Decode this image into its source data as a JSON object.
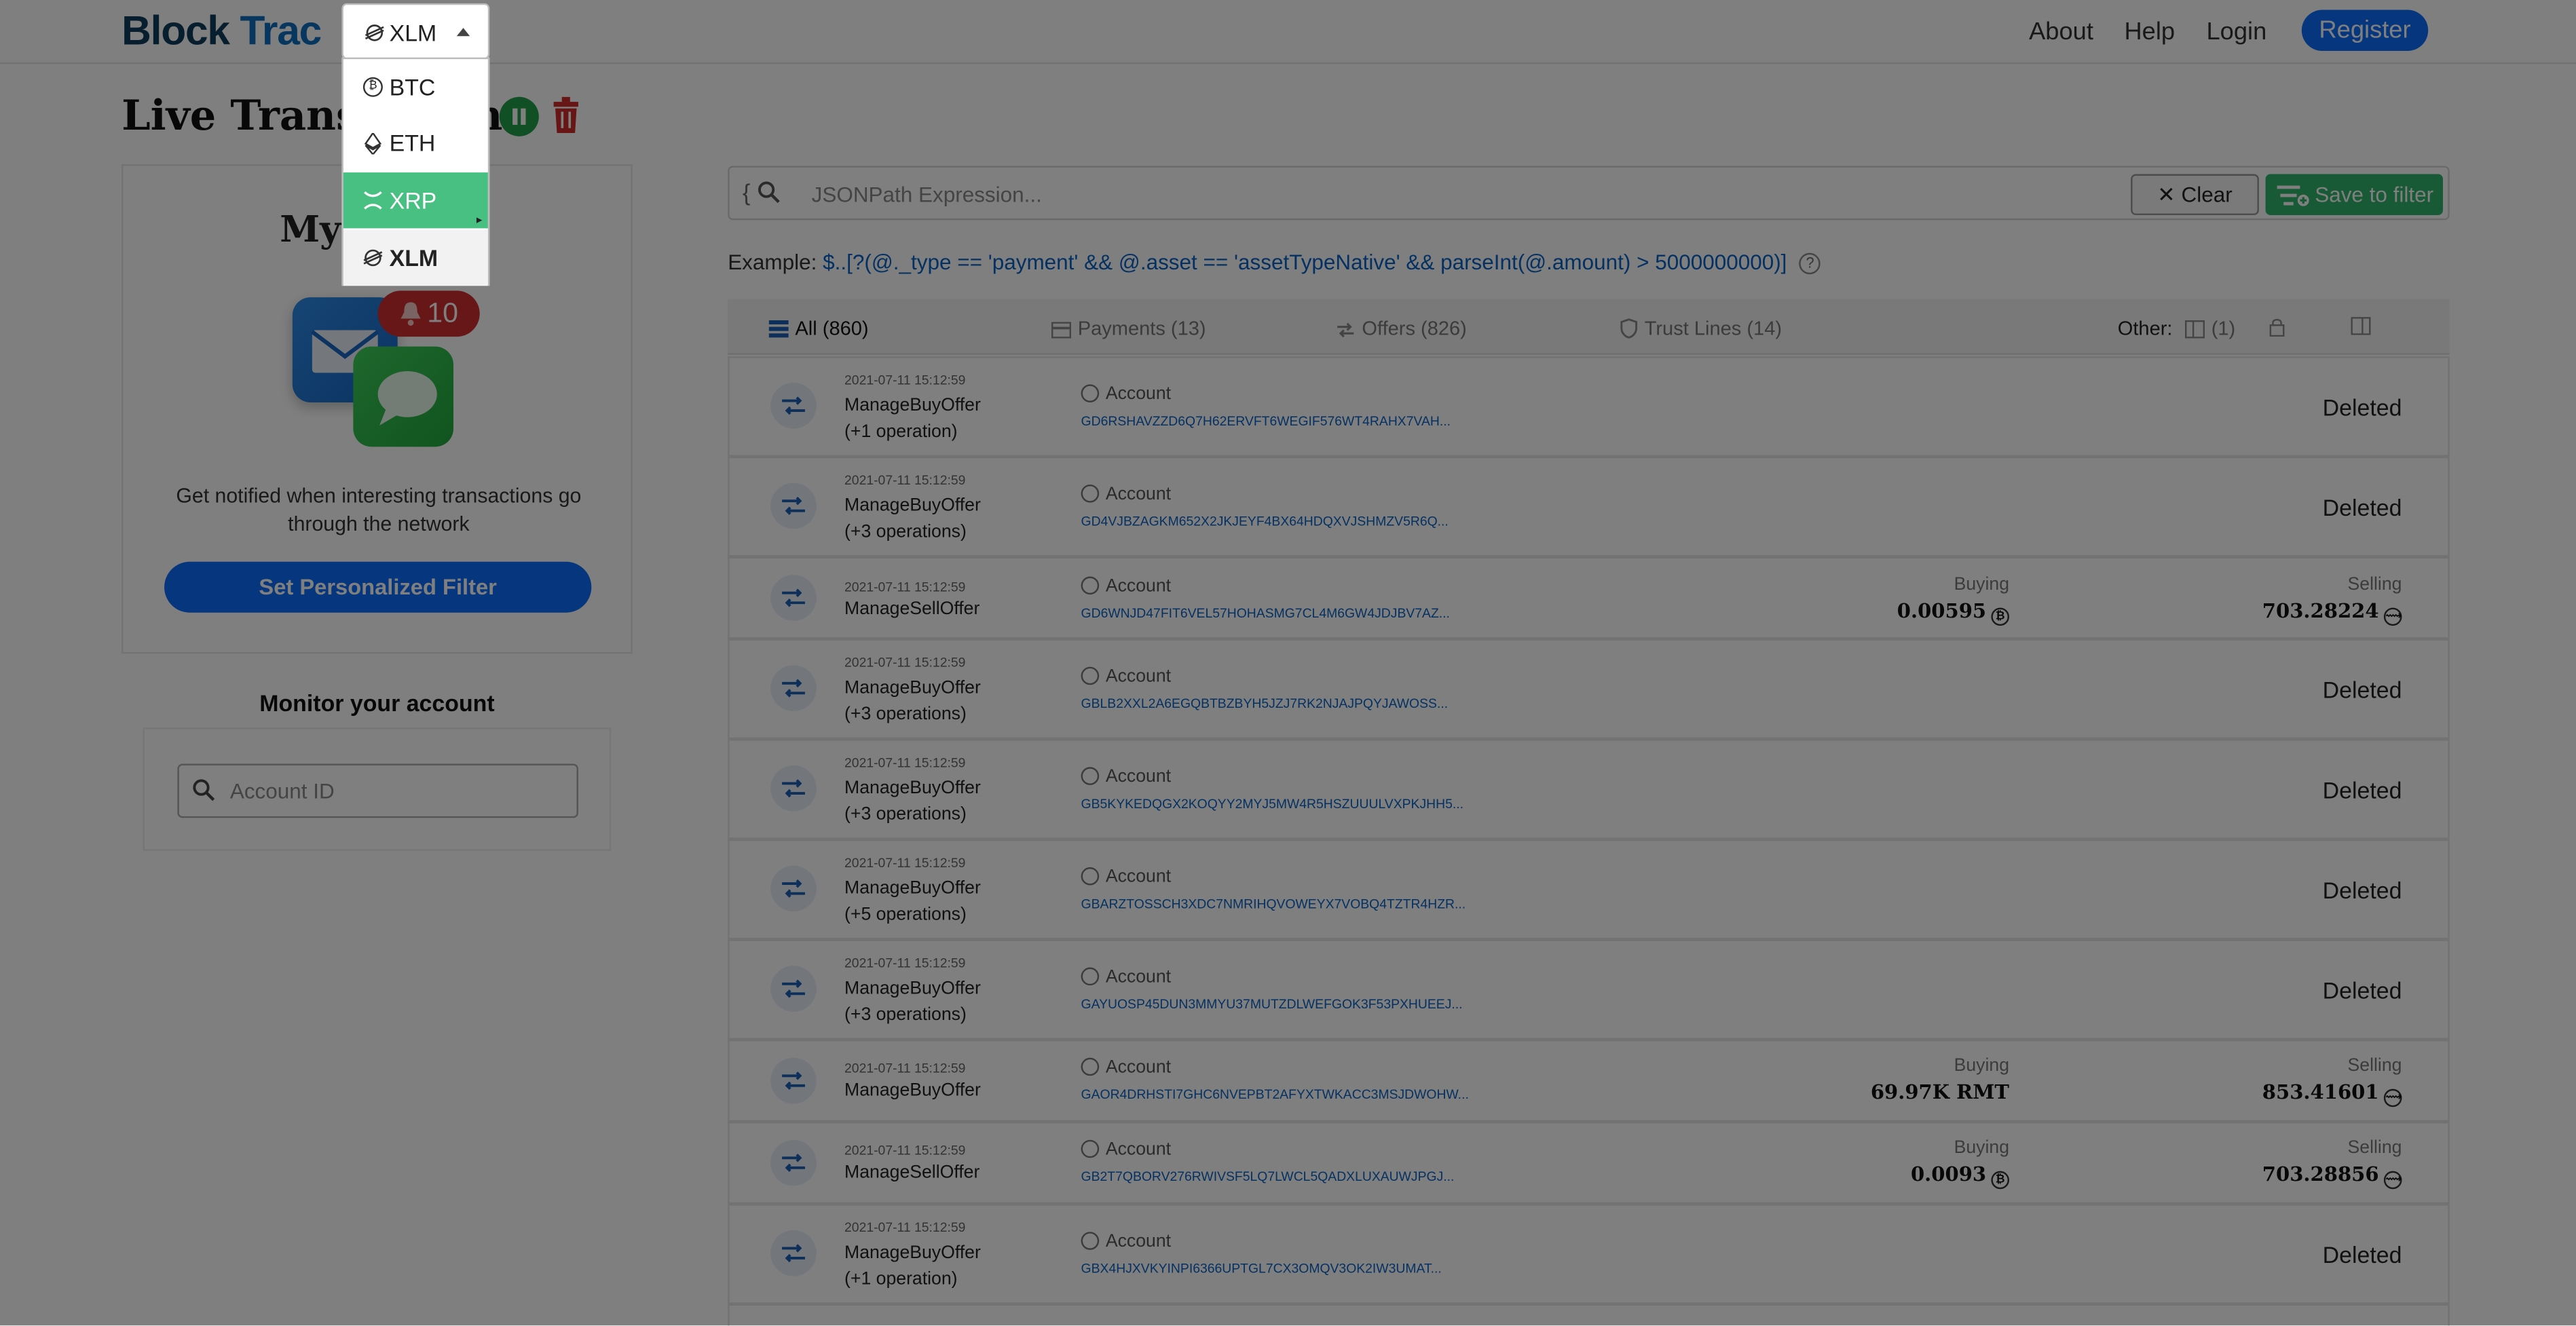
{
  "brand": {
    "part1": "Block",
    "part2": "Trac"
  },
  "nav": {
    "about": "About",
    "help": "Help",
    "login": "Login",
    "register": "Register"
  },
  "page_title": "Live Transactions",
  "filter_card": {
    "title": "My Alerts",
    "badge_count": "10",
    "description": "Get notified when interesting transactions go through the network",
    "button": "Set Personalized Filter"
  },
  "monitor": {
    "title": "Monitor your account",
    "placeholder": "Account ID"
  },
  "search": {
    "prefix": "{",
    "placeholder": "JSONPath Expression...",
    "clear": "Clear",
    "save": "Save to filter"
  },
  "example": {
    "label": "Example:",
    "code": "$..[?(@._type == 'payment' && @.asset == 'assetTypeNative' && parseInt(@.amount) > 5000000000)]",
    "help": "?"
  },
  "tabs": {
    "all": "All (860)",
    "payments": "Payments (13)",
    "offers": "Offers (826)",
    "trust": "Trust Lines (14)",
    "other_label": "Other:",
    "other_count": "(1)"
  },
  "rows": [
    {
      "time": "2021-07-11 15:12:59",
      "type": "ManageBuyOffer",
      "ops": "(+1 operation)",
      "account_label": "Account",
      "account": "GD6RSHAVZZD6Q7H62ERVFT6WEGIF576WT4RAHX7VAH...",
      "status": "Deleted"
    },
    {
      "time": "2021-07-11 15:12:59",
      "type": "ManageBuyOffer",
      "ops": "(+3 operations)",
      "account_label": "Account",
      "account": "GD4VJBZAGKM652X2JKJEYF4BX64HDQXVJSHMZV5R6Q...",
      "status": "Deleted"
    },
    {
      "time": "2021-07-11 15:12:59",
      "type": "ManageSellOffer",
      "ops": "",
      "account_label": "Account",
      "account": "GD6WNJD47FIT6VEL57HOHASMG7CL4M6GW4JDJBV7AZ...",
      "buying_label": "Buying",
      "buying": "0.00595",
      "selling_label": "Selling",
      "selling": "703.28224"
    },
    {
      "time": "2021-07-11 15:12:59",
      "type": "ManageBuyOffer",
      "ops": "(+3 operations)",
      "account_label": "Account",
      "account": "GBLB2XXL2A6EGQBTBZBYH5JZJ7RK2NJAJPQYJAWOSS...",
      "status": "Deleted"
    },
    {
      "time": "2021-07-11 15:12:59",
      "type": "ManageBuyOffer",
      "ops": "(+3 operations)",
      "account_label": "Account",
      "account": "GB5KYKEDQGX2KOQYY2MYJ5MW4R5HSZUUULVXPKJHH5...",
      "status": "Deleted"
    },
    {
      "time": "2021-07-11 15:12:59",
      "type": "ManageBuyOffer",
      "ops": "(+5 operations)",
      "account_label": "Account",
      "account": "GBARZTOSSCH3XDC7NMRIHQVOWEYX7VOBQ4TZTR4HZR...",
      "status": "Deleted"
    },
    {
      "time": "2021-07-11 15:12:59",
      "type": "ManageBuyOffer",
      "ops": "(+3 operations)",
      "account_label": "Account",
      "account": "GAYUOSP45DUN3MMYU37MUTZDLWEFGOK3F53PXHUEEJ...",
      "status": "Deleted"
    },
    {
      "time": "2021-07-11 15:12:59",
      "type": "ManageBuyOffer",
      "ops": "",
      "account_label": "Account",
      "account": "GAOR4DRHSTI7GHC6NVEPBT2AFYXTWKACC3MSJDWOHW...",
      "buying_label": "Buying",
      "buying": "69.97K RMT",
      "selling_label": "Selling",
      "selling": "853.41601"
    },
    {
      "time": "2021-07-11 15:12:59",
      "type": "ManageSellOffer",
      "ops": "",
      "account_label": "Account",
      "account": "GB2T7QBORV276RWIVSF5LQ7LWCL5QADXLUXAUWJPGJ...",
      "buying_label": "Buying",
      "buying": "0.0093",
      "selling_label": "Selling",
      "selling": "703.28856"
    },
    {
      "time": "2021-07-11 15:12:59",
      "type": "ManageBuyOffer",
      "ops": "(+1 operation)",
      "account_label": "Account",
      "account": "GBX4HJXVKYINPI6366UPTGL7CX3OMQV3OK2IW3UMAT...",
      "status": "Deleted"
    }
  ],
  "currency_select": {
    "selected": "XLM",
    "options": [
      "BTC",
      "ETH",
      "XRP",
      "XLM"
    ],
    "highlighted": "XRP"
  },
  "colors": {
    "brand_dark": "#0f3d5c",
    "brand_blue": "#0e6fbe",
    "primary": "#0d6efd",
    "success": "#22a04a",
    "danger": "#cf2f2f",
    "dropdown_highlight": "#47c082"
  }
}
